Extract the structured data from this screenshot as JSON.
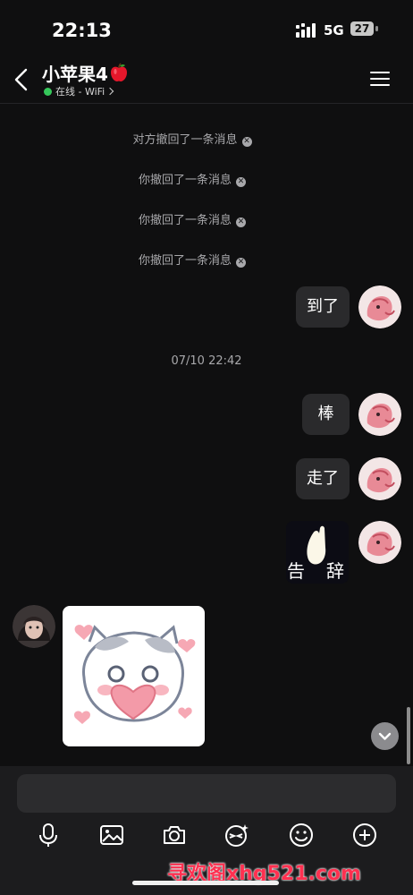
{
  "status_bar": {
    "time": "22:13",
    "network": "5G",
    "battery": "27"
  },
  "header": {
    "title": "小苹果4",
    "presence": "在线 - WiFi"
  },
  "chat": {
    "system_messages": [
      {
        "text": "对方撤回了一条消息"
      },
      {
        "text": "你撤回了一条消息"
      },
      {
        "text": "你撤回了一条消息"
      },
      {
        "text": "你撤回了一条消息"
      }
    ],
    "messages_sent": [
      {
        "text": "到了"
      },
      {
        "text": "棒"
      },
      {
        "text": "走了"
      }
    ],
    "timestamp": "07/10 22:42",
    "sticker_text_left": "告",
    "sticker_text_right": "辞"
  },
  "watermark": "寻欢阁xhg521.com",
  "colors": {
    "background": "#0f0f10",
    "bubble": "#2a2a2c",
    "online": "#35c65a",
    "watermark": "#ff3050"
  },
  "icons": [
    "back-icon",
    "apple-emoji-icon",
    "menu-icon",
    "recall-close-icon",
    "scroll-down-icon",
    "mic-icon",
    "image-icon",
    "camera-icon",
    "sticker-icon",
    "emoji-icon",
    "plus-icon"
  ]
}
